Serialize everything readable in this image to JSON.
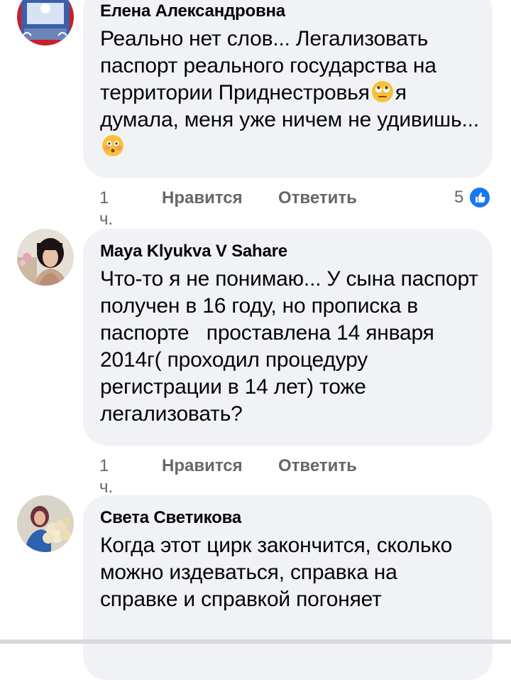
{
  "comments": [
    {
      "author": "Елена Александровна",
      "text_part1": "Реально нет слов... Легализовать паспорт реального государства на территории Приднестровья",
      "text_part2": "я думала, меня уже ничем не удивишь...",
      "time": "1 ч.",
      "like_label": "Нравится",
      "reply_label": "Ответить",
      "reaction_count": "5",
      "emojis": [
        "rolling-eyes-emoji",
        "flushed-face-emoji"
      ]
    },
    {
      "author": "Maya Klyukva V Sahare",
      "text": "Что-то я не понимаю... У сына паспорт получен в 16 году, но прописка в паспорте   проставлена 14 января 2014г( проходил процедуру регистрации в 14 лет) тоже легализовать?",
      "time": "1 ч.",
      "like_label": "Нравится",
      "reply_label": "Ответить"
    },
    {
      "author": "Света Светикова",
      "text": "Когда этот цирк закончится, сколько можно издеваться, справка на справке и справкой погоняет"
    }
  ],
  "colors": {
    "bubble": "#f0f2f5",
    "meta_text": "#65676b",
    "like_blue": "#1877f2"
  }
}
